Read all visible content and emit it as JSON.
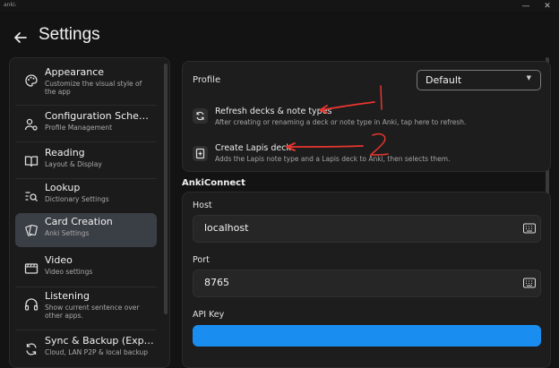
{
  "window": {
    "app_id": "ankiᵢ",
    "minimize": "—",
    "close": "✕"
  },
  "header": {
    "title": "Settings"
  },
  "sidebar": {
    "items": [
      {
        "label": "Appearance",
        "sub": "Customize the visual style of the app",
        "icon": "palette-icon"
      },
      {
        "label": "Configuration Sche…",
        "sub": "Profile Management",
        "icon": "profile-config-icon"
      },
      {
        "label": "Reading",
        "sub": "Layout & Display",
        "icon": "book-icon"
      },
      {
        "label": "Lookup",
        "sub": "Dictionary Settings",
        "icon": "search-list-icon"
      },
      {
        "label": "Card Creation",
        "sub": "Anki Settings",
        "icon": "cards-icon"
      },
      {
        "label": "Video",
        "sub": "Video settings",
        "icon": "video-icon"
      },
      {
        "label": "Listening",
        "sub": "Show current sentence over other apps.",
        "icon": "headphones-icon"
      },
      {
        "label": "Sync & Backup (Exp…",
        "sub": "Cloud, LAN P2P & local backup",
        "icon": "sync-icon"
      }
    ],
    "active_index": 4
  },
  "profile": {
    "label": "Profile",
    "selected": "Default",
    "actions": [
      {
        "title": "Refresh decks & note types",
        "sub": "After creating or renaming a deck or note type in Anki, tap here to refresh.",
        "icon": "refresh-icon"
      },
      {
        "title": "Create Lapis deck",
        "sub": "Adds the Lapis note type and a Lapis deck to Anki, then selects them.",
        "icon": "add-deck-icon"
      }
    ]
  },
  "ankiconnect": {
    "section": "AnkiConnect",
    "host_label": "Host",
    "host_value": "localhost",
    "port_label": "Port",
    "port_value": "8765",
    "apikey_label": "API Key",
    "apikey_value": ""
  },
  "colors": {
    "accent": "#1a8ef0",
    "annotation": "#e8362f",
    "active_nav": "#3a3e45"
  }
}
